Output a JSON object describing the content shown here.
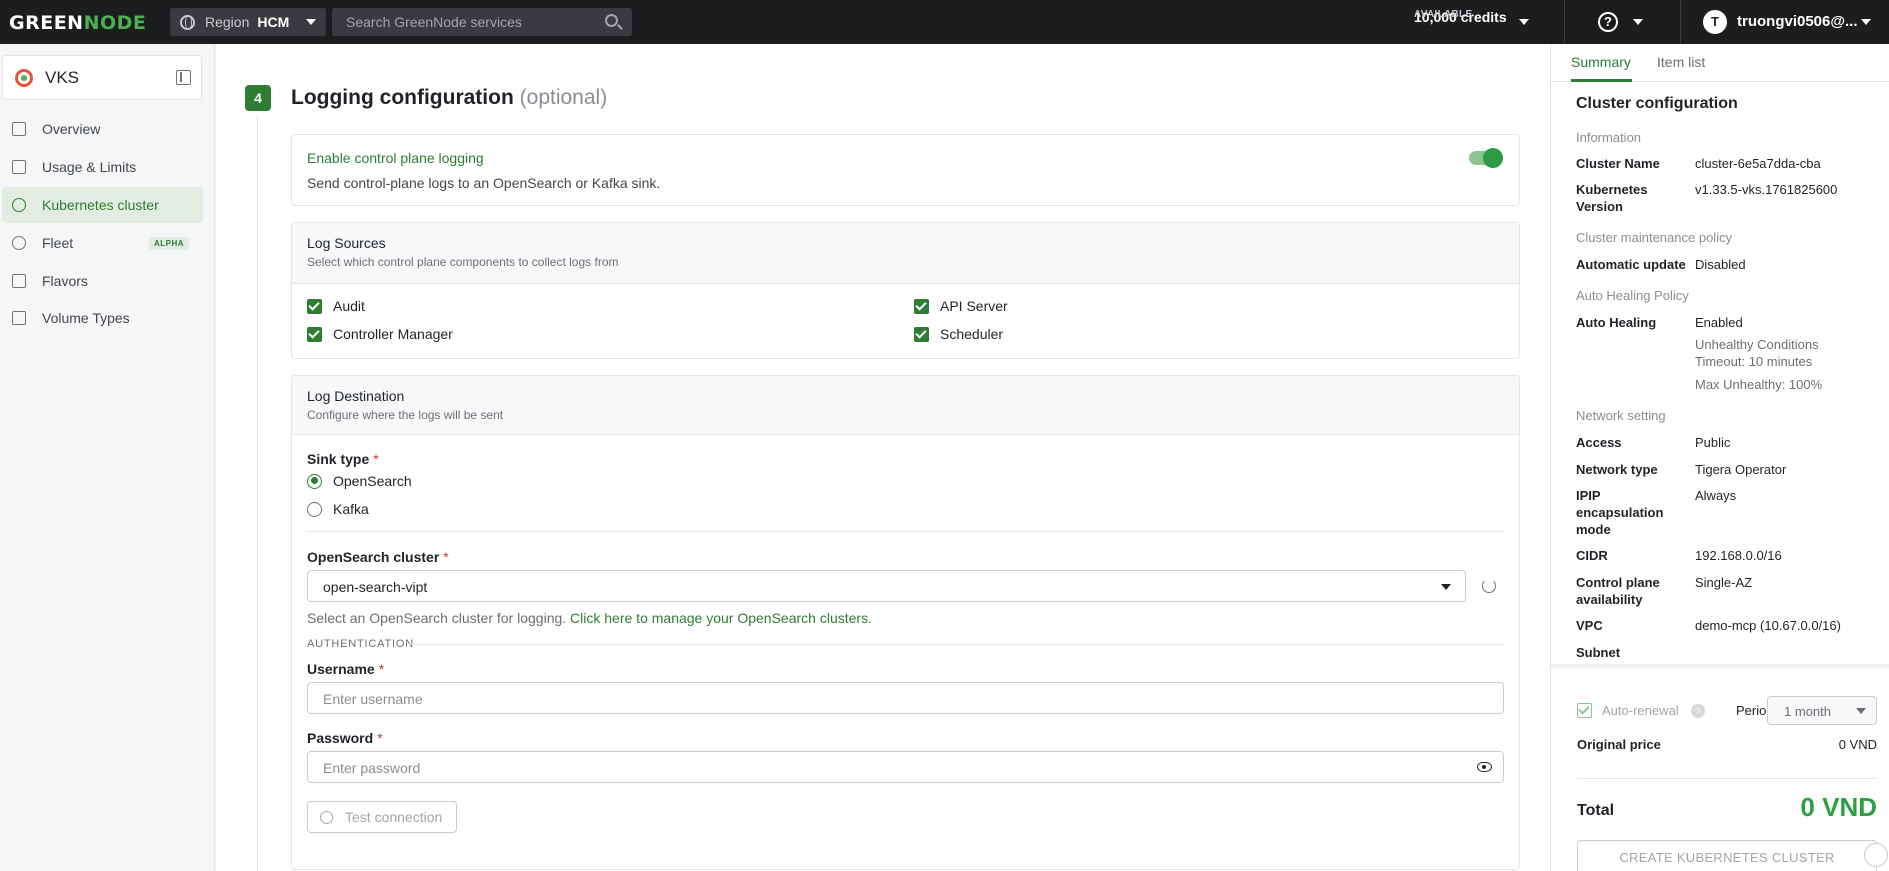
{
  "topbar": {
    "logo_left": "GREEN",
    "logo_right": "NODE",
    "region_label": "Region",
    "region_value": "HCM",
    "search_placeholder": "Search GreenNode services",
    "credits_label": "AVAILABLE",
    "credits_value": "10,000 credits",
    "help_glyph": "?",
    "avatar_initial": "T",
    "user_name": "truongvi0506@..."
  },
  "sidebar": {
    "service": "VKS",
    "items": [
      {
        "label": "Overview",
        "icon": "home-icon"
      },
      {
        "label": "Usage & Limits",
        "icon": "gauge-icon"
      },
      {
        "label": "Kubernetes cluster",
        "icon": "kubernetes-icon",
        "active": true
      },
      {
        "label": "Fleet",
        "icon": "fleet-icon",
        "badge": "ALPHA"
      },
      {
        "label": "Flavors",
        "icon": "dollar-icon"
      },
      {
        "label": "Volume Types",
        "icon": "volume-icon"
      }
    ]
  },
  "main": {
    "step": "4",
    "title": "Logging configuration",
    "title_optional": "(optional)",
    "control_plane": {
      "title": "Enable control plane logging",
      "desc": "Send control-plane logs to an OpenSearch or Kafka sink.",
      "enabled": true
    },
    "log_sources": {
      "title": "Log Sources",
      "subtitle": "Select which control plane components to collect logs from",
      "items": [
        "Audit",
        "API Server",
        "Controller Manager",
        "Scheduler"
      ]
    },
    "log_destination": {
      "title": "Log Destination",
      "subtitle": "Configure where the logs will be sent",
      "sink_type_label": "Sink type",
      "sink_options": [
        "OpenSearch",
        "Kafka"
      ],
      "sink_selected": "OpenSearch",
      "opensearch_label": "OpenSearch cluster",
      "opensearch_value": "open-search-vipt",
      "opensearch_help": "Select an OpenSearch cluster for logging.",
      "opensearch_link": "Click here to manage your OpenSearch clusters.",
      "auth_heading": "AUTHENTICATION",
      "username_label": "Username",
      "username_placeholder": "Enter username",
      "password_label": "Password",
      "password_placeholder": "Enter password",
      "test_button": "Test connection"
    }
  },
  "summary": {
    "tabs": [
      "Summary",
      "Item list"
    ],
    "title": "Cluster configuration",
    "information": "Information",
    "cluster_name_k": "Cluster Name",
    "cluster_name_v": "cluster-6e5a7dda-cba",
    "k8s_version_k": "Kubernetes Version",
    "k8s_version_v": "v1.33.5-vks.1761825600",
    "maintenance": "Cluster maintenance policy",
    "auto_update_k": "Automatic update",
    "auto_update_v": "Disabled",
    "auto_healing_policy": "Auto Healing Policy",
    "auto_healing_k": "Auto Healing",
    "auto_healing_v": "Enabled",
    "unhealthy": "Unhealthy Conditions Timeout: 10 minutes",
    "max_unhealthy": "Max Unhealthy: 100%",
    "network_setting": "Network setting",
    "access_k": "Access",
    "access_v": "Public",
    "network_type_k": "Network type",
    "network_type_v": "Tigera Operator",
    "ipip_k": "IPIP encapsulation mode",
    "ipip_v": "Always",
    "cidr_k": "CIDR",
    "cidr_v": "192.168.0.0/16",
    "cp_avail_k": "Control plane availability",
    "cp_avail_v": "Single-AZ",
    "vpc_k": "VPC",
    "vpc_v": "demo-mcp (10.67.0.0/16)",
    "subnet_k": "Subnet"
  },
  "pricing": {
    "auto_renewal": "Auto-renewal",
    "help_glyph": "?",
    "period_label": "Period",
    "period_value": "1 month",
    "original_price_k": "Original price",
    "original_price_v": "0 VND",
    "total_k": "Total",
    "total_v": "0 VND",
    "create_button": "CREATE KUBERNETES CLUSTER"
  },
  "colors": {
    "accent": "#2e7d32",
    "topbar": "#1c1d1f",
    "total": "#2ea043"
  }
}
